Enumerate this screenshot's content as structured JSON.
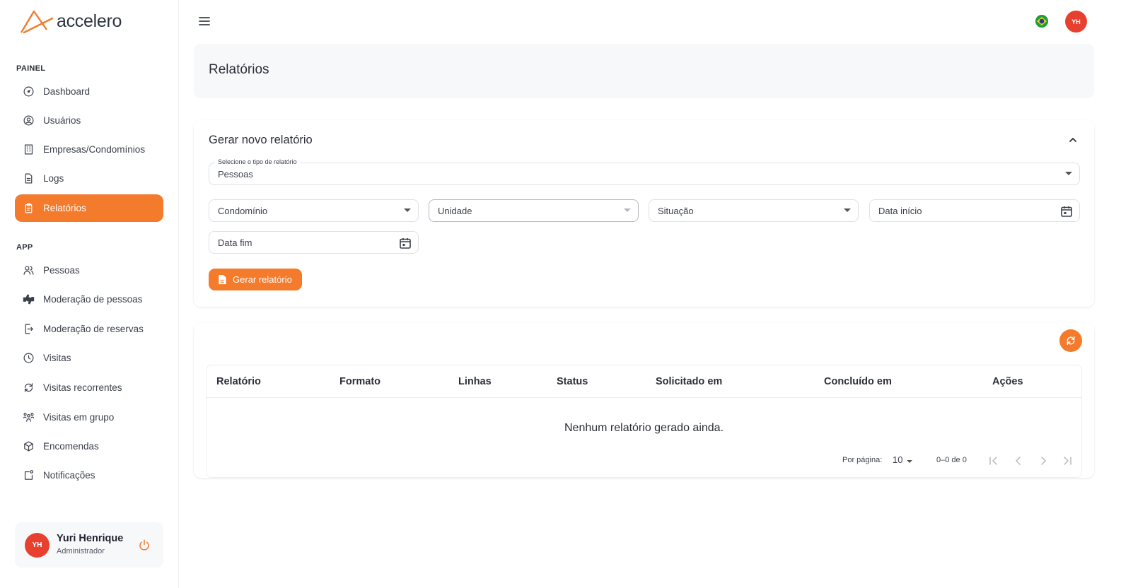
{
  "brand": {
    "name": "accelero",
    "accent": "#f47a2c"
  },
  "sidebar": {
    "section_painel": "PAINEL",
    "painel_items": [
      {
        "label": "Dashboard",
        "icon": "gauge-icon"
      },
      {
        "label": "Usuários",
        "icon": "user-circle-icon"
      },
      {
        "label": "Empresas/Condomínios",
        "icon": "building-icon"
      },
      {
        "label": "Logs",
        "icon": "document-icon"
      },
      {
        "label": "Relatórios",
        "icon": "clipboard-icon",
        "active": true
      }
    ],
    "section_app": "APP",
    "app_items": [
      {
        "label": "Pessoas",
        "icon": "people-icon"
      },
      {
        "label": "Moderação de pessoas",
        "icon": "thumbs-icon"
      },
      {
        "label": "Moderação de reservas",
        "icon": "door-exit-icon"
      },
      {
        "label": "Visitas",
        "icon": "clock-icon"
      },
      {
        "label": "Visitas recorrentes",
        "icon": "recurring-arrows-icon"
      },
      {
        "label": "Visitas em grupo",
        "icon": "group-icon"
      },
      {
        "label": "Encomendas",
        "icon": "package-icon"
      },
      {
        "label": "Notificações",
        "icon": "notification-icon"
      }
    ],
    "user": {
      "initials": "YH",
      "name": "Yuri Henrique",
      "role": "Administrador"
    }
  },
  "topbar": {
    "avatar_initials": "YH"
  },
  "page": {
    "title": "Relatórios"
  },
  "form": {
    "title": "Gerar novo relatório",
    "report_type": {
      "label": "Selecione o tipo de relatório",
      "value": "Pessoas"
    },
    "condominio": "Condomínio",
    "unidade": "Unidade",
    "situacao": "Situação",
    "data_inicio": "Data início",
    "data_fim": "Data fim",
    "submit_label": "Gerar relatório"
  },
  "table": {
    "columns": [
      "Relatório",
      "Formato",
      "Linhas",
      "Status",
      "Solicitado em",
      "Concluído em",
      "Ações"
    ],
    "rows": [],
    "empty_message": "Nenhum relatório gerado ainda.",
    "pagination": {
      "per_page_label": "Por página:",
      "per_page_value": "10",
      "range": "0–0 de 0"
    }
  }
}
